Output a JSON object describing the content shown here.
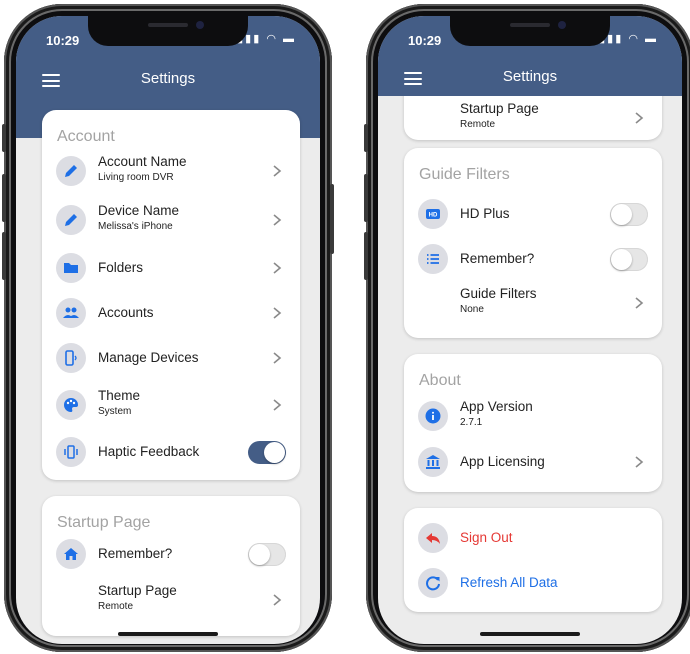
{
  "colors": {
    "accent": "#445d86",
    "icon_bg": "#dcdde3",
    "icon_blue": "#1e6fe6",
    "danger": "#e53935",
    "section_title": "#a3a3a3"
  },
  "left": {
    "status": {
      "time": "10:29"
    },
    "nav": {
      "title": "Settings"
    },
    "account": {
      "title": "Account",
      "items": [
        {
          "label": "Account Name",
          "value": "Living room DVR",
          "icon": "pencil-icon"
        },
        {
          "label": "Device Name",
          "value": "Melissa's iPhone",
          "icon": "pencil-icon"
        },
        {
          "label": "Folders",
          "icon": "folder-icon"
        },
        {
          "label": "Accounts",
          "icon": "people-icon"
        },
        {
          "label": "Manage Devices",
          "icon": "devices-icon"
        },
        {
          "label": "Theme",
          "value": "System",
          "icon": "palette-icon"
        },
        {
          "label": "Haptic Feedback",
          "icon": "vibration-icon",
          "toggle": true
        }
      ]
    },
    "startup": {
      "title": "Startup Page",
      "items": [
        {
          "label": "Remember?",
          "icon": "home-icon",
          "toggle": false
        },
        {
          "label": "Startup Page",
          "value": "Remote"
        }
      ]
    }
  },
  "right": {
    "status": {
      "time": "10:29"
    },
    "nav": {
      "title": "Settings"
    },
    "startup_partial": {
      "label": "Startup Page",
      "value": "Remote"
    },
    "guide": {
      "title": "Guide Filters",
      "items": [
        {
          "label": "HD Plus",
          "icon": "hd-icon",
          "toggle": false
        },
        {
          "label": "Remember?",
          "icon": "list-icon",
          "toggle": false
        },
        {
          "label": "Guide Filters",
          "value": "None"
        }
      ]
    },
    "about": {
      "title": "About",
      "items": [
        {
          "label": "App Version",
          "value": "2.7.1",
          "icon": "info-icon"
        },
        {
          "label": "App Licensing",
          "icon": "bank-icon"
        }
      ]
    },
    "actions": {
      "sign_out": "Sign Out",
      "refresh": "Refresh All Data"
    }
  }
}
